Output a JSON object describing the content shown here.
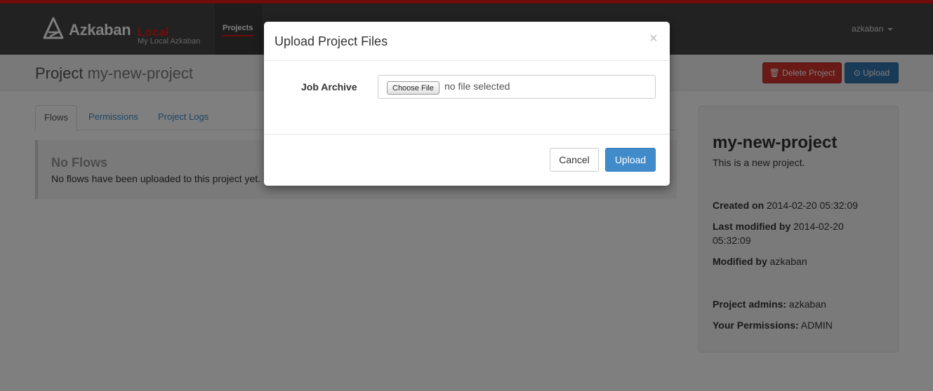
{
  "navbar": {
    "brand": "Azkaban",
    "env": "Local",
    "subtitle": "My Local Azkaban",
    "projects_link": "Projects",
    "user": "azkaban",
    "logo_icon": "azkaban-logo",
    "accent_color": "#e01818"
  },
  "page_header": {
    "title_prefix": "Project",
    "project_name": "my-new-project",
    "delete_icon": "trash-icon",
    "delete_label": "Delete Project",
    "upload_icon": "upload-circle-icon",
    "upload_label": "Upload"
  },
  "tabs": [
    {
      "label": "Flows",
      "active": true
    },
    {
      "label": "Permissions",
      "active": false
    },
    {
      "label": "Project Logs",
      "active": false
    }
  ],
  "flows": {
    "heading": "No Flows",
    "message": "No flows have been uploaded to this project yet."
  },
  "panel": {
    "name": "my-new-project",
    "description": "This is a new project.",
    "created_label": "Created on",
    "created_value": "2014-02-20 05:32:09",
    "modified_label": "Last modified by",
    "modified_value": "2014-02-20 05:32:09",
    "modified_by_label": "Modified by",
    "modified_by_value": "azkaban",
    "admins_label": "Project admins:",
    "admins_value": "azkaban",
    "permissions_label": "Your Permissions:",
    "permissions_value": "ADMIN"
  },
  "modal": {
    "title": "Upload Project Files",
    "close": "×",
    "field_label": "Job Archive",
    "choose_file": "Choose File",
    "no_file": "no file selected",
    "cancel": "Cancel",
    "upload": "Upload"
  }
}
